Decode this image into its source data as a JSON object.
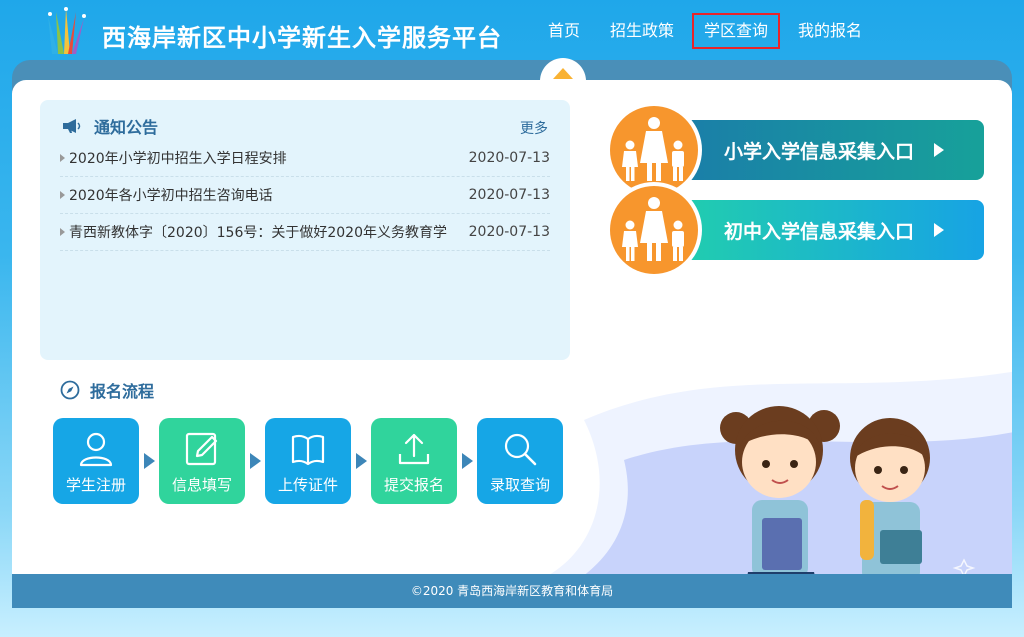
{
  "header": {
    "site_title": "西海岸新区中小学新生入学服务平台",
    "nav": [
      {
        "label": "首页"
      },
      {
        "label": "招生政策"
      },
      {
        "label": "学区查询"
      },
      {
        "label": "我的报名"
      }
    ],
    "active_nav": "学区查询"
  },
  "notice": {
    "title": "通知公告",
    "more": "更多",
    "items": [
      {
        "title": "2020年小学初中招生入学日程安排",
        "date": "2020-07-13"
      },
      {
        "title": "2020年各小学初中招生咨询电话",
        "date": "2020-07-13"
      },
      {
        "title": "青西新教体字〔2020〕156号：关于做好2020年义务教育学",
        "date": "2020-07-13"
      }
    ]
  },
  "process": {
    "title": "报名流程",
    "steps": [
      {
        "label": "学生注册",
        "icon": "user-icon"
      },
      {
        "label": "信息填写",
        "icon": "edit-icon"
      },
      {
        "label": "上传证件",
        "icon": "book-icon"
      },
      {
        "label": "提交报名",
        "icon": "upload-icon"
      },
      {
        "label": "录取查询",
        "icon": "search-icon"
      }
    ]
  },
  "entries": {
    "primary": "小学入学信息采集入口",
    "middle": "初中入学信息采集入口"
  },
  "footer": {
    "copyright": "©2020 青岛西海岸新区教育和体育局"
  },
  "colors": {
    "brand_blue": "#1fa7ea",
    "step_blue": "#16a6e6",
    "step_green": "#30d49c",
    "badge_orange": "#f7962d",
    "nav_highlight": "#e8242a"
  }
}
